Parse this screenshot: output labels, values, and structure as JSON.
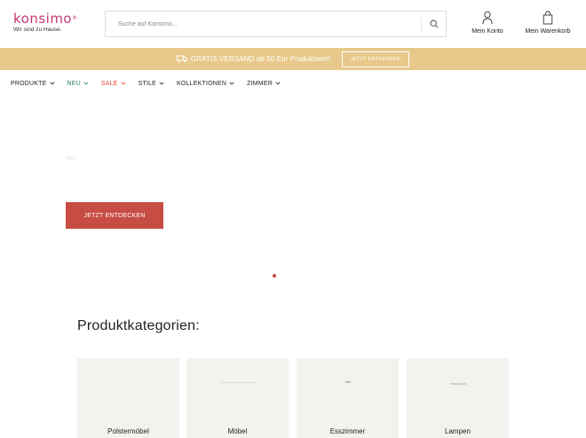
{
  "header": {
    "logo_text": "konsimo",
    "logo_reg": "®",
    "logo_tagline": "Wir sind zu Hause.",
    "search_placeholder": "Suche auf Konsimo...",
    "account_label": "Mein Konto",
    "cart_label": "Mein Warenkorb"
  },
  "promo": {
    "text": "GRATIS VERSAND ab 50 Eur Produktwert!",
    "button": "JETZT ENTDECKEN"
  },
  "nav": {
    "items": [
      {
        "label": "PRODUKTE"
      },
      {
        "label": "NEU"
      },
      {
        "label": "SALE"
      },
      {
        "label": "STILE"
      },
      {
        "label": "KOLLEKTIONEN"
      },
      {
        "label": "ZIMMER"
      }
    ]
  },
  "hero": {
    "eyebrow": "Neu",
    "cta": "JETZT ENTDECKEN"
  },
  "categories": {
    "title": "Produktkategorien:",
    "items": [
      {
        "label": "Polstermöbel"
      },
      {
        "label": "Möbel"
      },
      {
        "label": "Esszimmer"
      },
      {
        "label": "Lampen"
      }
    ]
  },
  "colors": {
    "brand": "#c43a72",
    "promo_bg": "#e8c98b",
    "accent_red": "#c74c43",
    "nav_neu": "#2a7f6f",
    "nav_sale": "#e0412e"
  }
}
